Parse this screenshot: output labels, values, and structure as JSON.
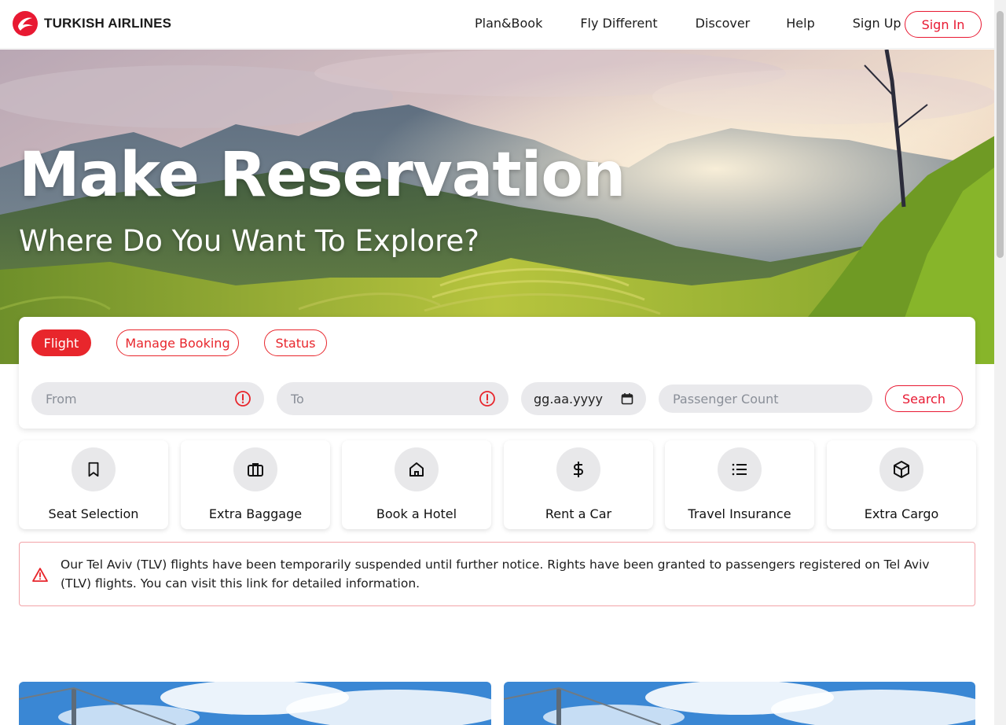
{
  "brand": {
    "name": "TURKISH AIRLINES",
    "accent_color": "#e81932"
  },
  "nav": {
    "items": [
      "Plan&Book",
      "Fly Different",
      "Discover",
      "Help",
      "Sign Up"
    ],
    "sign_in_label": "Sign In"
  },
  "hero": {
    "title": "Make Reservation",
    "subtitle": "Where Do You Want To Explore?"
  },
  "booking": {
    "tabs": [
      {
        "label": "Flight",
        "active": true
      },
      {
        "label": "Manage Booking",
        "active": false
      },
      {
        "label": "Status",
        "active": false
      }
    ],
    "from_placeholder": "From",
    "to_placeholder": "To",
    "date_value": "gg.aa.yyyy",
    "passenger_placeholder": "Passenger Count",
    "search_label": "Search"
  },
  "services": [
    {
      "label": "Seat Selection",
      "icon": "bookmark-icon"
    },
    {
      "label": "Extra Baggage",
      "icon": "briefcase-icon"
    },
    {
      "label": "Book a Hotel",
      "icon": "home-icon"
    },
    {
      "label": "Rent a Car",
      "icon": "dollar-icon"
    },
    {
      "label": "Travel Insurance",
      "icon": "list-icon"
    },
    {
      "label": "Extra Cargo",
      "icon": "package-icon"
    }
  ],
  "notice": {
    "icon": "warning-triangle-icon",
    "text": "Our Tel Aviv (TLV) flights have been temporarily suspended until further notice. Rights have been granted to passengers registered on Tel Aviv (TLV) flights. You can visit this link for detailed information."
  }
}
